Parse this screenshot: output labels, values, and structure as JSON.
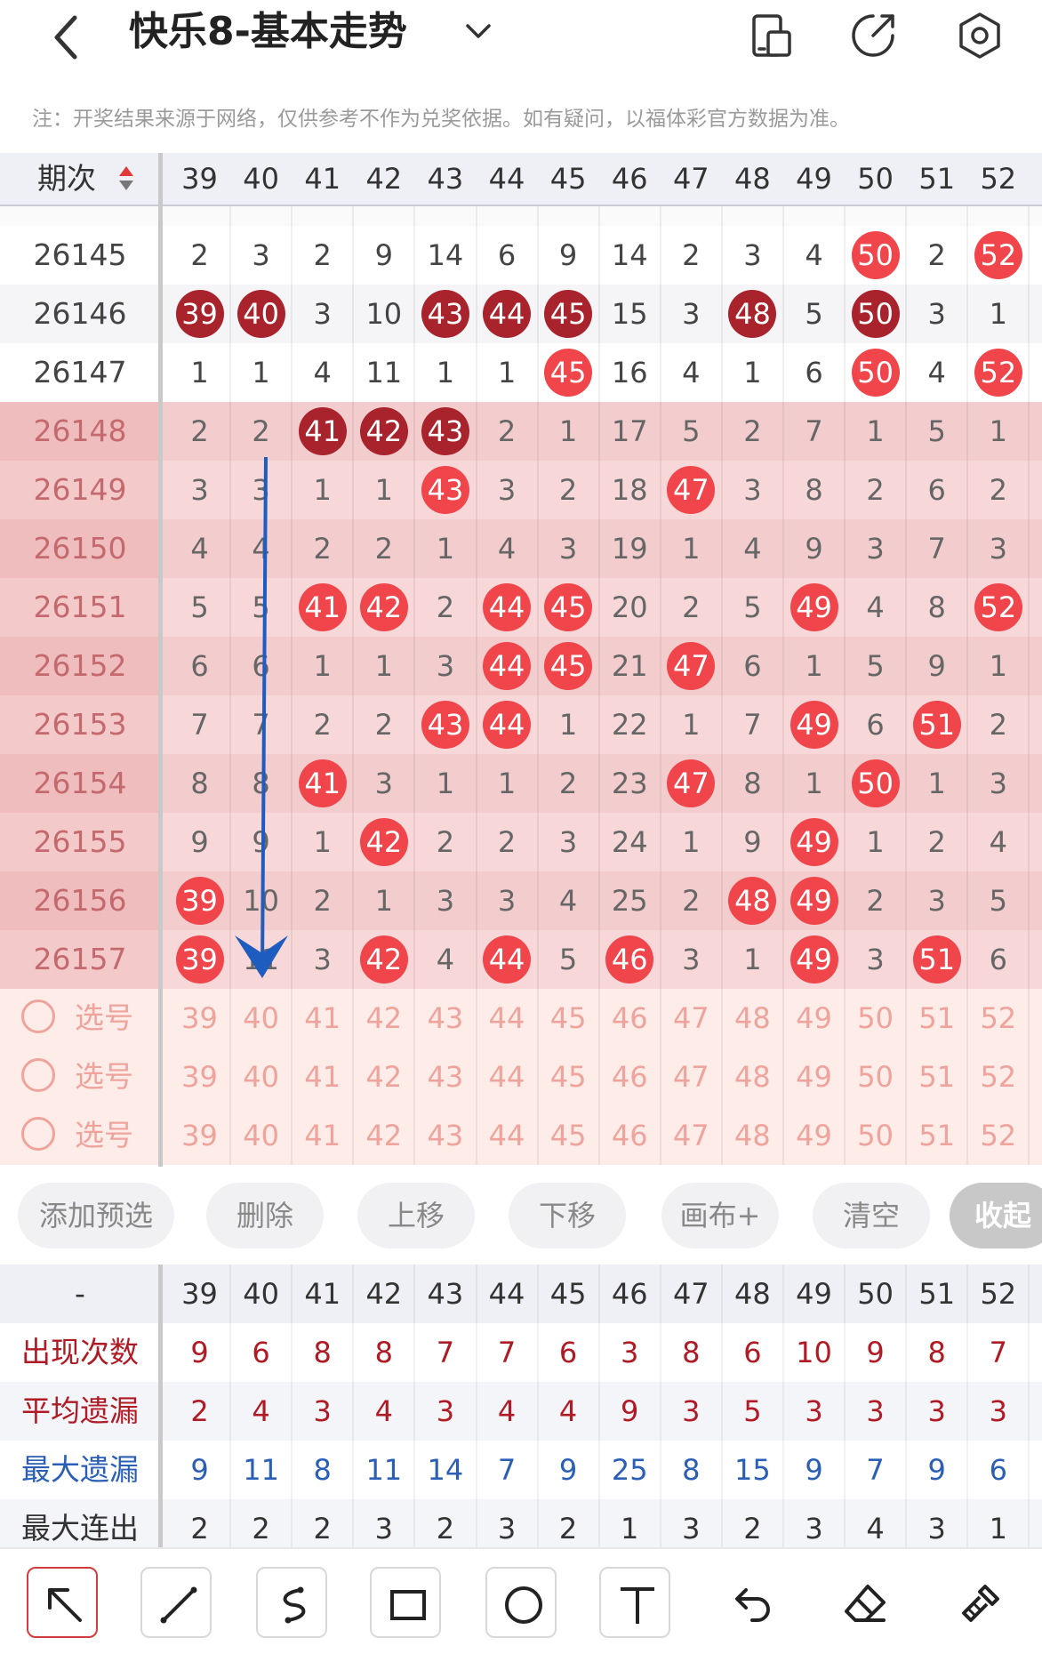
{
  "header": {
    "title": "快乐8-基本走势",
    "notice": "注：开奖结果来源于网络，仅供参考不作为兑奖依据。如有疑问，以福体彩官方数据为准。"
  },
  "table": {
    "period_header": "期次",
    "columns": [
      "39",
      "40",
      "41",
      "42",
      "43",
      "44",
      "45",
      "46",
      "47",
      "48",
      "49",
      "50",
      "51",
      "52"
    ],
    "rows": [
      {
        "period": "26145",
        "highlight": false,
        "cells": [
          "2",
          "3",
          "2",
          "9",
          "14",
          "6",
          "9",
          "14",
          "2",
          "3",
          "4",
          "50",
          "2",
          "52"
        ],
        "hits": [
          11,
          13
        ]
      },
      {
        "period": "26146",
        "highlight": false,
        "cells": [
          "39",
          "40",
          "3",
          "10",
          "43",
          "44",
          "45",
          "15",
          "3",
          "48",
          "5",
          "50",
          "3",
          "1"
        ],
        "hits": [
          0,
          1,
          4,
          5,
          6,
          9,
          11
        ]
      },
      {
        "period": "26147",
        "highlight": false,
        "cells": [
          "1",
          "1",
          "4",
          "11",
          "1",
          "1",
          "45",
          "16",
          "4",
          "1",
          "6",
          "50",
          "4",
          "52"
        ],
        "hits": [
          6,
          11,
          13
        ]
      },
      {
        "period": "26148",
        "highlight": true,
        "cells": [
          "2",
          "2",
          "41",
          "42",
          "43",
          "2",
          "1",
          "17",
          "5",
          "2",
          "7",
          "1",
          "5",
          "1"
        ],
        "hits": [
          2,
          3,
          4
        ]
      },
      {
        "period": "26149",
        "highlight": true,
        "cells": [
          "3",
          "3",
          "1",
          "1",
          "43",
          "3",
          "2",
          "18",
          "47",
          "3",
          "8",
          "2",
          "6",
          "2"
        ],
        "hits": [
          4,
          8
        ]
      },
      {
        "period": "26150",
        "highlight": true,
        "cells": [
          "4",
          "4",
          "2",
          "2",
          "1",
          "4",
          "3",
          "19",
          "1",
          "4",
          "9",
          "3",
          "7",
          "3"
        ],
        "hits": []
      },
      {
        "period": "26151",
        "highlight": true,
        "cells": [
          "5",
          "5",
          "41",
          "42",
          "2",
          "44",
          "45",
          "20",
          "2",
          "5",
          "49",
          "4",
          "8",
          "52"
        ],
        "hits": [
          2,
          3,
          5,
          6,
          10,
          13
        ]
      },
      {
        "period": "26152",
        "highlight": true,
        "cells": [
          "6",
          "6",
          "1",
          "1",
          "3",
          "44",
          "45",
          "21",
          "47",
          "6",
          "1",
          "5",
          "9",
          "1"
        ],
        "hits": [
          5,
          6,
          8
        ]
      },
      {
        "period": "26153",
        "highlight": true,
        "cells": [
          "7",
          "7",
          "2",
          "2",
          "43",
          "44",
          "1",
          "22",
          "1",
          "7",
          "49",
          "6",
          "51",
          "2"
        ],
        "hits": [
          4,
          5,
          10,
          12
        ]
      },
      {
        "period": "26154",
        "highlight": true,
        "cells": [
          "8",
          "8",
          "41",
          "3",
          "1",
          "1",
          "2",
          "23",
          "47",
          "8",
          "1",
          "50",
          "1",
          "3"
        ],
        "hits": [
          2,
          8,
          11
        ]
      },
      {
        "period": "26155",
        "highlight": true,
        "cells": [
          "9",
          "9",
          "1",
          "42",
          "2",
          "2",
          "3",
          "24",
          "1",
          "9",
          "49",
          "1",
          "2",
          "4"
        ],
        "hits": [
          3,
          10
        ]
      },
      {
        "period": "26156",
        "highlight": true,
        "cells": [
          "39",
          "10",
          "2",
          "1",
          "3",
          "3",
          "4",
          "25",
          "2",
          "48",
          "49",
          "2",
          "3",
          "5"
        ],
        "hits": [
          0,
          9,
          10
        ]
      },
      {
        "period": "26157",
        "highlight": true,
        "cells": [
          "39",
          "11",
          "3",
          "42",
          "4",
          "44",
          "5",
          "46",
          "3",
          "1",
          "49",
          "3",
          "51",
          "6"
        ],
        "hits": [
          0,
          3,
          5,
          7,
          10,
          12
        ]
      }
    ],
    "select_label": "选号",
    "select_rows": 3
  },
  "colors": {
    "ball_dark": "#a8232c",
    "ball_light": "#f0454a",
    "highlight_row": "#f7d7d8",
    "highlight_row_alt": "#f3cccd",
    "select_bg": "#fdece7",
    "select_text": "#efa39d",
    "stat_red": "#b01a24",
    "stat_blue": "#2a5fb5",
    "arrow": "#1e5cc0",
    "active_tool": "#d23c3c"
  },
  "buttons": [
    "添加预选",
    "删除",
    "上移",
    "下移",
    "画布+",
    "清空",
    "收起"
  ],
  "stats": {
    "header_label": "-",
    "rows": [
      {
        "label": "出现次数",
        "color": "red",
        "values": [
          "9",
          "6",
          "8",
          "8",
          "7",
          "7",
          "6",
          "3",
          "8",
          "6",
          "10",
          "9",
          "8",
          "7"
        ]
      },
      {
        "label": "平均遗漏",
        "color": "red",
        "values": [
          "2",
          "4",
          "3",
          "4",
          "3",
          "4",
          "4",
          "9",
          "3",
          "5",
          "3",
          "3",
          "3",
          "3"
        ]
      },
      {
        "label": "最大遗漏",
        "color": "blue",
        "values": [
          "9",
          "11",
          "8",
          "11",
          "14",
          "7",
          "9",
          "25",
          "8",
          "15",
          "9",
          "7",
          "9",
          "6"
        ]
      },
      {
        "label": "最大连出",
        "color": "dark",
        "values": [
          "2",
          "2",
          "2",
          "3",
          "2",
          "3",
          "2",
          "1",
          "3",
          "2",
          "3",
          "4",
          "3",
          "1"
        ]
      }
    ]
  },
  "toolbar": {
    "tools": [
      "arrow-tool-icon",
      "line-tool-icon",
      "curve-tool-icon",
      "rectangle-tool-icon",
      "circle-tool-icon",
      "text-tool-icon",
      "undo-icon",
      "eraser-icon",
      "clear-brush-icon"
    ],
    "active": 0
  }
}
